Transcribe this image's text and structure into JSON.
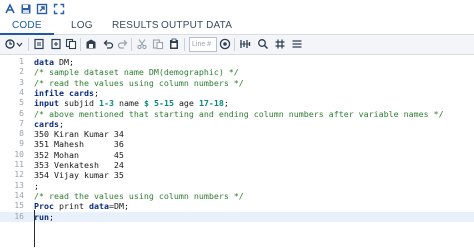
{
  "top_icons": [
    "run-icon",
    "save-icon",
    "export-icon",
    "maximize-icon"
  ],
  "tabs": [
    {
      "label": "CODE",
      "active": true
    },
    {
      "label": "LOG",
      "active": false
    },
    {
      "label": "RESULTS",
      "active": false
    },
    {
      "label": "OUTPUT DATA",
      "active": false
    }
  ],
  "toolbar": {
    "line_placeholder": "Line #",
    "icons": [
      "run-dropdown-icon",
      "open-icon",
      "new-icon",
      "copy-icon",
      "save-icon",
      "undo-icon",
      "redo-icon",
      "cut-icon",
      "paste-icon",
      "clipboard-icon",
      "goto-line-icon",
      "format-icon",
      "search-icon",
      "grid-icon",
      "wrap-icon"
    ]
  },
  "colors": {
    "accent": "#1e5aa8",
    "keyword": "#0b2a88",
    "comment": "#2f7d32",
    "number": "#0a8a7a"
  },
  "lines": [
    {
      "n": "1",
      "text": "data DM;"
    },
    {
      "n": "2",
      "text": "/* sample dataset name DM(demographic) */"
    },
    {
      "n": "3",
      "text": "/* read the values using column numbers */"
    },
    {
      "n": "4",
      "text": "infile cards;"
    },
    {
      "n": "5",
      "text": "input subjid 1-3 name $ 5-15 age 17-18;"
    },
    {
      "n": "6",
      "text": "/* above mentioned that starting and ending column numbers after variable names */"
    },
    {
      "n": "7",
      "text": "cards;"
    },
    {
      "n": "8",
      "text": "350 Kiran Kumar 34"
    },
    {
      "n": "9",
      "text": "351 Mahesh      36"
    },
    {
      "n": "10",
      "text": "352 Mohan       45"
    },
    {
      "n": "11",
      "text": "353 Venkatesh   24"
    },
    {
      "n": "12",
      "text": "354 Vijay kumar 35"
    },
    {
      "n": "13",
      "text": ";"
    },
    {
      "n": "14",
      "text": "/* read the values using column numbers */"
    },
    {
      "n": "15",
      "text": "Proc print data=DM;"
    },
    {
      "n": "16",
      "text": "run;"
    }
  ]
}
